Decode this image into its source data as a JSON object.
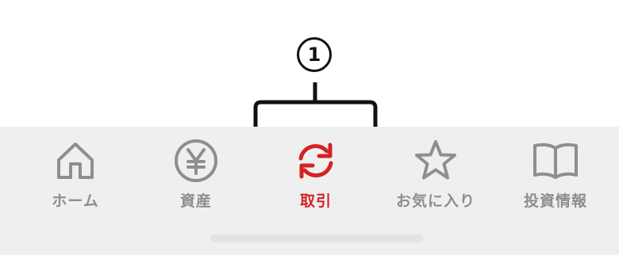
{
  "annotation": {
    "callout_number": "1"
  },
  "colors": {
    "active": "#d42323",
    "inactive": "#8e8e8e",
    "tabbar_bg": "#efefef"
  },
  "tabbar": {
    "active_tab": "取引",
    "tabs": [
      {
        "label": "ホーム",
        "icon": "home-icon",
        "active": false
      },
      {
        "label": "資産",
        "icon": "yen-coin-icon",
        "active": false
      },
      {
        "label": "取引",
        "icon": "refresh-arrows-icon",
        "active": true
      },
      {
        "label": "お気に入り",
        "icon": "star-icon",
        "active": false
      },
      {
        "label": "投資情報",
        "icon": "open-book-icon",
        "active": false
      }
    ]
  }
}
